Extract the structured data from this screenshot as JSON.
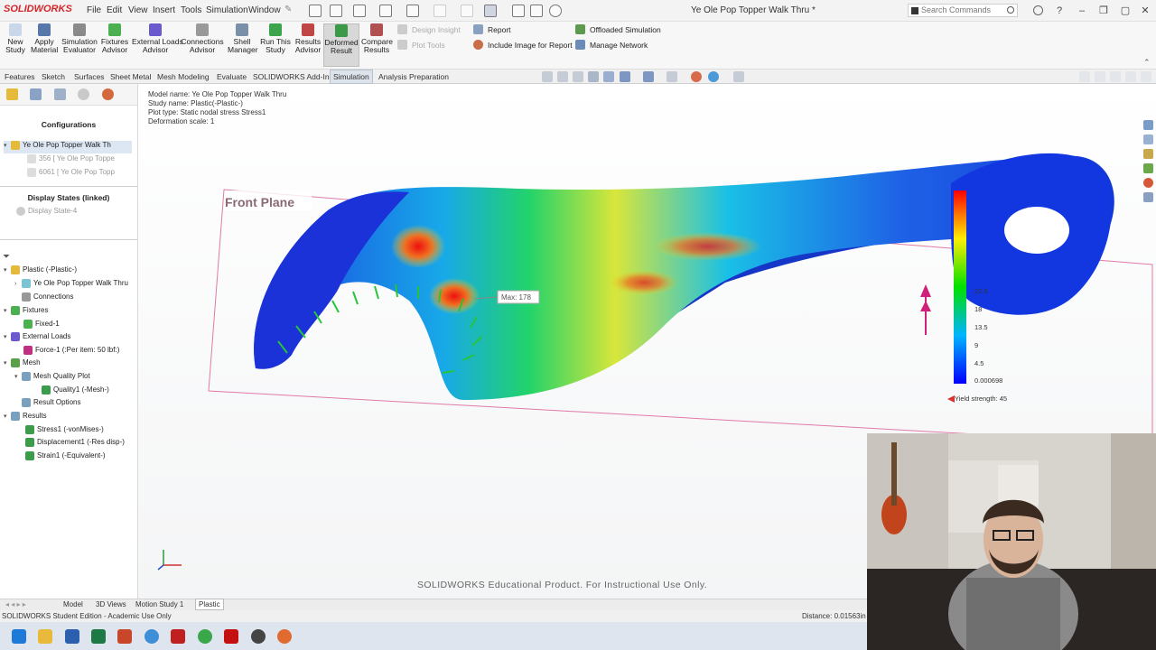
{
  "app": {
    "logo": "SOLIDWORKS",
    "menu": [
      "File",
      "Edit",
      "View",
      "Insert",
      "Tools",
      "Simulation",
      "Window"
    ],
    "document_title": "Ye Ole Pop Topper Walk Thru *",
    "search_placeholder": "Search Commands"
  },
  "ribbon": {
    "buttons": [
      {
        "label": "New\nStudy",
        "icon": "new-study-icon"
      },
      {
        "label": "Apply\nMaterial",
        "icon": "material-icon"
      },
      {
        "label": "Simulation\nEvaluator",
        "icon": "evaluator-icon"
      },
      {
        "label": "Fixtures\nAdvisor",
        "icon": "fixture-icon"
      },
      {
        "label": "External Loads\nAdvisor",
        "icon": "load-icon"
      },
      {
        "label": "Connections\nAdvisor",
        "icon": "connection-icon"
      },
      {
        "label": "Shell\nManager",
        "icon": "shell-icon"
      },
      {
        "label": "Run This\nStudy",
        "icon": "run-icon"
      },
      {
        "label": "Results\nAdvisor",
        "icon": "results-icon"
      },
      {
        "label": "Deformed\nResult",
        "icon": "deformed-icon"
      },
      {
        "label": "Compare\nResults",
        "icon": "compare-icon"
      }
    ],
    "side_items": {
      "design_insight": "Design Insight",
      "plot_tools": "Plot Tools",
      "report": "Report",
      "include_image": "Include Image for Report",
      "offloaded": "Offloaded Simulation",
      "manage_network": "Manage Network"
    }
  },
  "command_tabs": [
    "Features",
    "Sketch",
    "Surfaces",
    "Sheet Metal",
    "Mesh Modeling",
    "Evaluate",
    "SOLIDWORKS Add-Ins",
    "Simulation",
    "Analysis Preparation"
  ],
  "active_command_tab": "Simulation",
  "left_panel": {
    "configurations_header": "Configurations",
    "config_items": [
      "Ye Ole Pop Topper Walk Th",
      "356 [ Ye Ole Pop Toppe",
      "6061 [ Ye Ole Pop Topp"
    ],
    "display_states_header": "Display States (linked)",
    "display_state": "Display State-4",
    "tree": [
      {
        "label": "Plastic (-Plastic-)",
        "indent": 0
      },
      {
        "label": "Ye Ole Pop Topper Walk Thru",
        "indent": 1
      },
      {
        "label": "Connections",
        "indent": 1
      },
      {
        "label": "Fixtures",
        "indent": 0
      },
      {
        "label": "Fixed-1",
        "indent": 2
      },
      {
        "label": "External Loads",
        "indent": 0
      },
      {
        "label": "Force-1 (:Per item: 50 lbf:)",
        "indent": 2
      },
      {
        "label": "Mesh",
        "indent": 0
      },
      {
        "label": "Mesh Quality Plot",
        "indent": 1
      },
      {
        "label": "Quality1 (-Mesh-)",
        "indent": 2
      },
      {
        "label": "Result Options",
        "indent": 1
      },
      {
        "label": "Results",
        "indent": 0
      },
      {
        "label": "Stress1 (-vonMises-)",
        "indent": 1
      },
      {
        "label": "Displacement1 (-Res disp-)",
        "indent": 1
      },
      {
        "label": "Strain1 (-Equivalent-)",
        "indent": 1
      }
    ]
  },
  "viewport": {
    "info": [
      "Model name: Ye Ole Pop Topper Walk Thru",
      "Study name: Plastic(-Plastic-)",
      "Plot type: Static nodal stress Stress1",
      "Deformation scale: 1"
    ],
    "plane_label": "Front Plane",
    "max_label": "Max: 178",
    "legend_ticks": [
      "22.5",
      "18",
      "13.5",
      "9",
      "4.5",
      "0.000698"
    ],
    "yield_strength": "Yield strength: 45",
    "watermark": "SOLIDWORKS Educational Product. For Instructional Use Only."
  },
  "bottom_tabs": [
    "Model",
    "3D Views",
    "Motion Study 1",
    "Plastic"
  ],
  "active_bottom_tab": "Plastic",
  "status": {
    "left": "SOLIDWORKS Student Edition - Academic Use Only",
    "right": "Distance: 0.01563in"
  },
  "colors": {
    "accent_red": "#d5262a",
    "active_tab_bg": "#dde3ea",
    "taskbar": "#dfe5ee"
  }
}
